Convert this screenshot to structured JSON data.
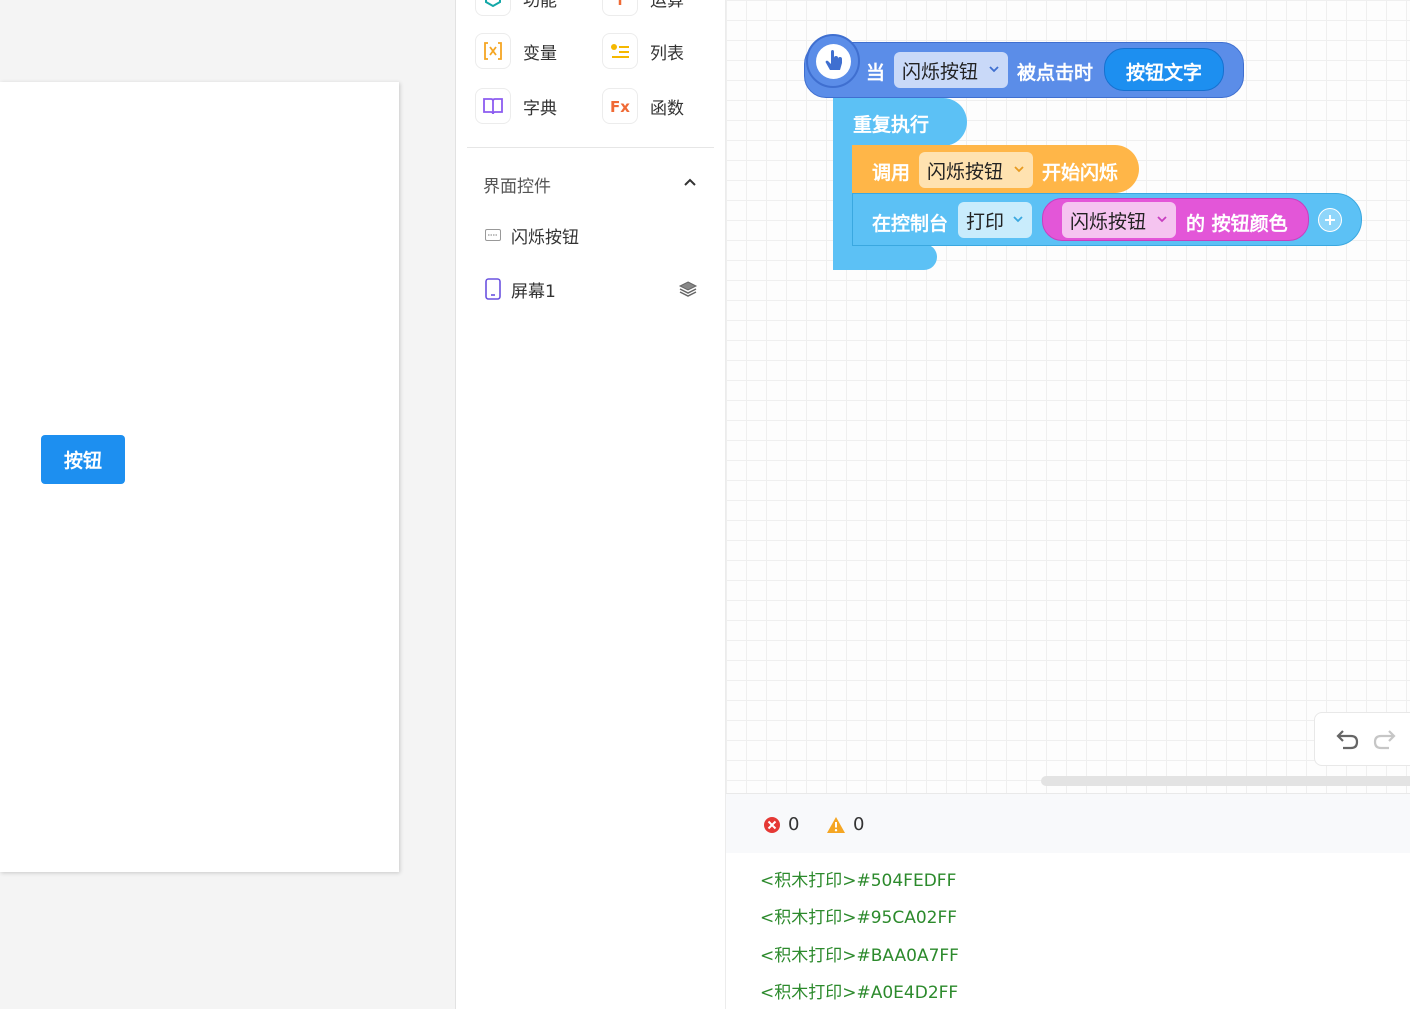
{
  "preview": {
    "button_label": "按钮"
  },
  "palette": {
    "top_partial": [
      {
        "label": "功能",
        "icon": "cube-icon",
        "color": "#13a8a8"
      },
      {
        "label": "运算",
        "icon": "operator-icon",
        "color": "#f06a35"
      }
    ],
    "categories": [
      {
        "label": "变量",
        "icon": "variable-icon",
        "color": "#f5a623"
      },
      {
        "label": "列表",
        "icon": "list-icon",
        "color": "#f5b800"
      },
      {
        "label": "字典",
        "icon": "book-icon",
        "color": "#8c5cf0"
      },
      {
        "label": "函数",
        "icon": "function-icon",
        "color": "#f06a35"
      }
    ],
    "section_title": "界面控件",
    "tree": [
      {
        "label": "闪烁按钮",
        "icon": "button-component-icon"
      },
      {
        "label": "屏幕1",
        "icon": "phone-screen-icon"
      }
    ]
  },
  "blocks": {
    "event": {
      "when_label": "当",
      "component": "闪烁按钮",
      "clicked_label": "被点击时",
      "param": "按钮文字",
      "color": "#5b8de8"
    },
    "repeat": {
      "label": "重复执行",
      "color": "#5cc1f5"
    },
    "call": {
      "label": "调用",
      "component": "闪烁按钮",
      "method": "开始闪烁",
      "color": "#ffb648"
    },
    "print": {
      "label": "在控制台",
      "mode": "打印",
      "component": "闪烁按钮",
      "property": "的 按钮颜色",
      "color": "#5cc1f5",
      "property_color": "#e356d8"
    }
  },
  "console": {
    "error_count": "0",
    "warning_count": "0",
    "logs": [
      "<积木打印>#504FEDFF",
      "<积木打印>#95CA02FF",
      "<积木打印>#BAA0A7FF",
      "<积木打印>#A0E4D2FF"
    ]
  }
}
